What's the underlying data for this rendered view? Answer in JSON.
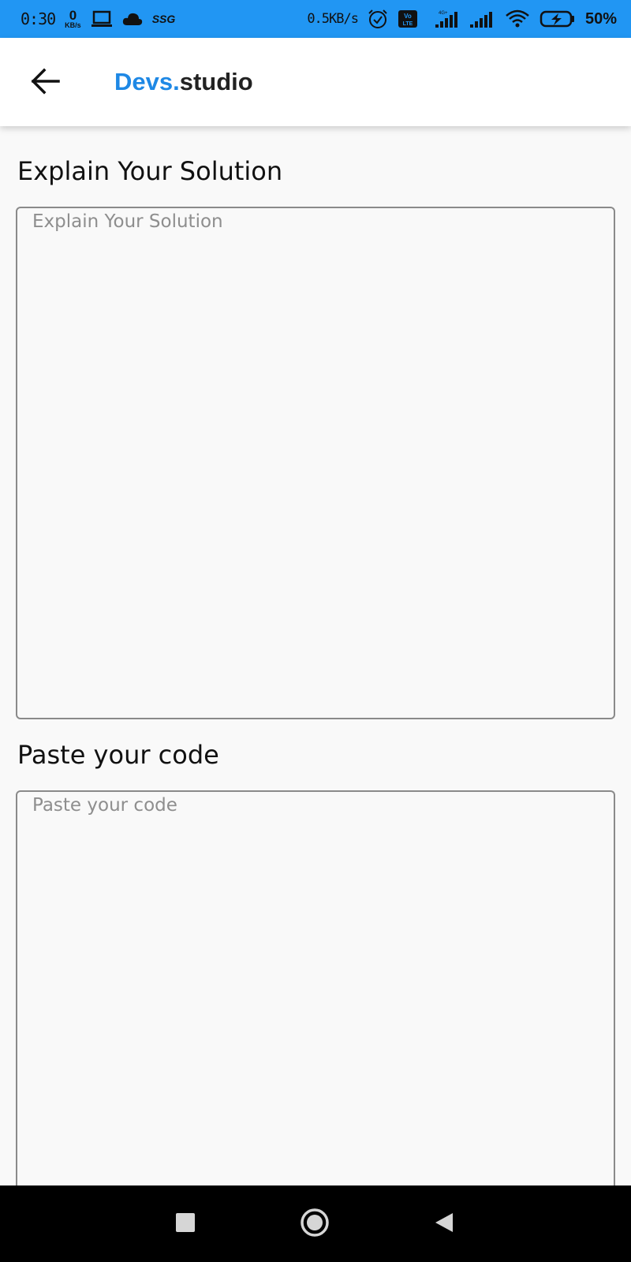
{
  "status_bar": {
    "time": "0:30",
    "net_speed_small_value": "0",
    "net_speed_small_unit": "KB/s",
    "ssg_label": "SSG",
    "net_rate": "0.5KB/s",
    "volte_label": "Vo LTE",
    "battery_text": "50%",
    "color": "#2196f3"
  },
  "app_bar": {
    "brand_accent": "Devs.",
    "brand_rest": "studio",
    "brand_accent_color": "#1e88e5"
  },
  "form": {
    "solution_label": "Explain Your Solution",
    "solution_placeholder": "Explain Your Solution",
    "code_label": "Paste your code",
    "code_placeholder": "Paste your code"
  },
  "icons": {
    "back": "arrow-left-icon",
    "nav_recent": "square-icon",
    "nav_home": "circle-icon",
    "nav_back": "triangle-left-icon"
  }
}
